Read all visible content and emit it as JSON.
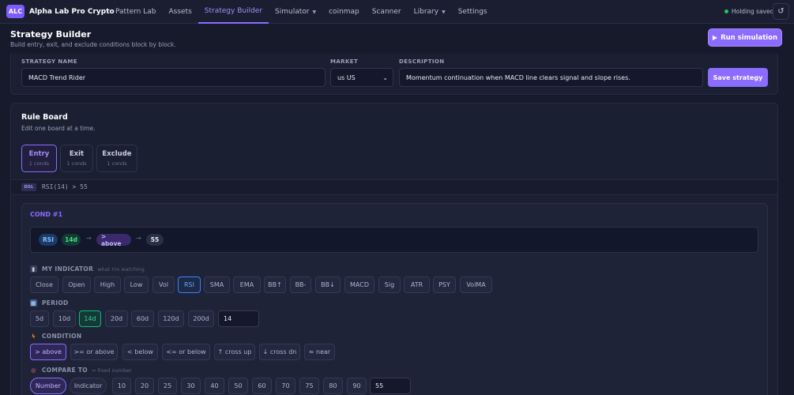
{
  "app": {
    "logo": "ALC",
    "name": "Alpha Lab Pro Crypto"
  },
  "nav": [
    {
      "label": "Pattern Lab"
    },
    {
      "label": "Assets"
    },
    {
      "label": "Strategy Builder"
    },
    {
      "label": "Simulator"
    },
    {
      "label": "coinmap"
    },
    {
      "label": "Scanner"
    },
    {
      "label": "Library"
    },
    {
      "label": "Settings"
    }
  ],
  "status": {
    "holding": "Holding saved",
    "refresh_icon": "↺"
  },
  "header": {
    "title": "Strategy Builder",
    "subtitle": "Build entry, exit, and exclude conditions block by block.",
    "run_label": "Run simulation",
    "run_icon": "▶"
  },
  "strategy": {
    "name_label": "STRATEGY NAME",
    "name_value": "MACD Trend Rider",
    "market_label": "MARKET",
    "market_value": "us US",
    "desc_label": "DESCRIPTION",
    "desc_value": "Momentum continuation when MACD line clears signal and slope rises.",
    "save_label": "Save strategy"
  },
  "rule_board": {
    "title": "Rule Board",
    "subtitle": "Edit one board at a time.",
    "tabs": [
      {
        "name": "Entry",
        "count": "1 conds"
      },
      {
        "name": "Exit",
        "count": "1 conds"
      },
      {
        "name": "Exclude",
        "count": "1 conds"
      }
    ],
    "dsl_badge": "DSL",
    "dsl_text": "RSI(14) > 55"
  },
  "cond": {
    "title": "COND #1",
    "preview": {
      "indicator": "RSI",
      "period": "14d",
      "op": "> above",
      "value": "55",
      "arrow": "→"
    },
    "indicator_label": "MY INDICATOR",
    "indicator_hint": "what I'm watching",
    "indicators": [
      "Close",
      "Open",
      "High",
      "Low",
      "Vol",
      "RSI",
      "SMA",
      "EMA",
      "BB↑",
      "BB-",
      "BB↓",
      "MACD",
      "Sig",
      "ATR",
      "PSY",
      "VolMA"
    ],
    "period_label": "PERIOD",
    "periods": [
      "5d",
      "10d",
      "14d",
      "20d",
      "60d",
      "120d",
      "200d"
    ],
    "period_value": "14",
    "condition_label": "CONDITION",
    "conditions": [
      "> above",
      ">= or above",
      "< below",
      "<= or below",
      "↑ cross up",
      "↓ cross dn",
      "≈ near"
    ],
    "compare_label": "COMPARE TO",
    "compare_hint": "= fixed number",
    "compare_modes": [
      "Number",
      "Indicator"
    ],
    "numbers": [
      "10",
      "20",
      "25",
      "30",
      "40",
      "50",
      "60",
      "70",
      "75",
      "80",
      "90"
    ],
    "compare_value": "55"
  },
  "colors": {
    "accent": "#8b6cff",
    "blue": "#3b82f6",
    "green": "#10b981",
    "bg": "#161a2b"
  }
}
